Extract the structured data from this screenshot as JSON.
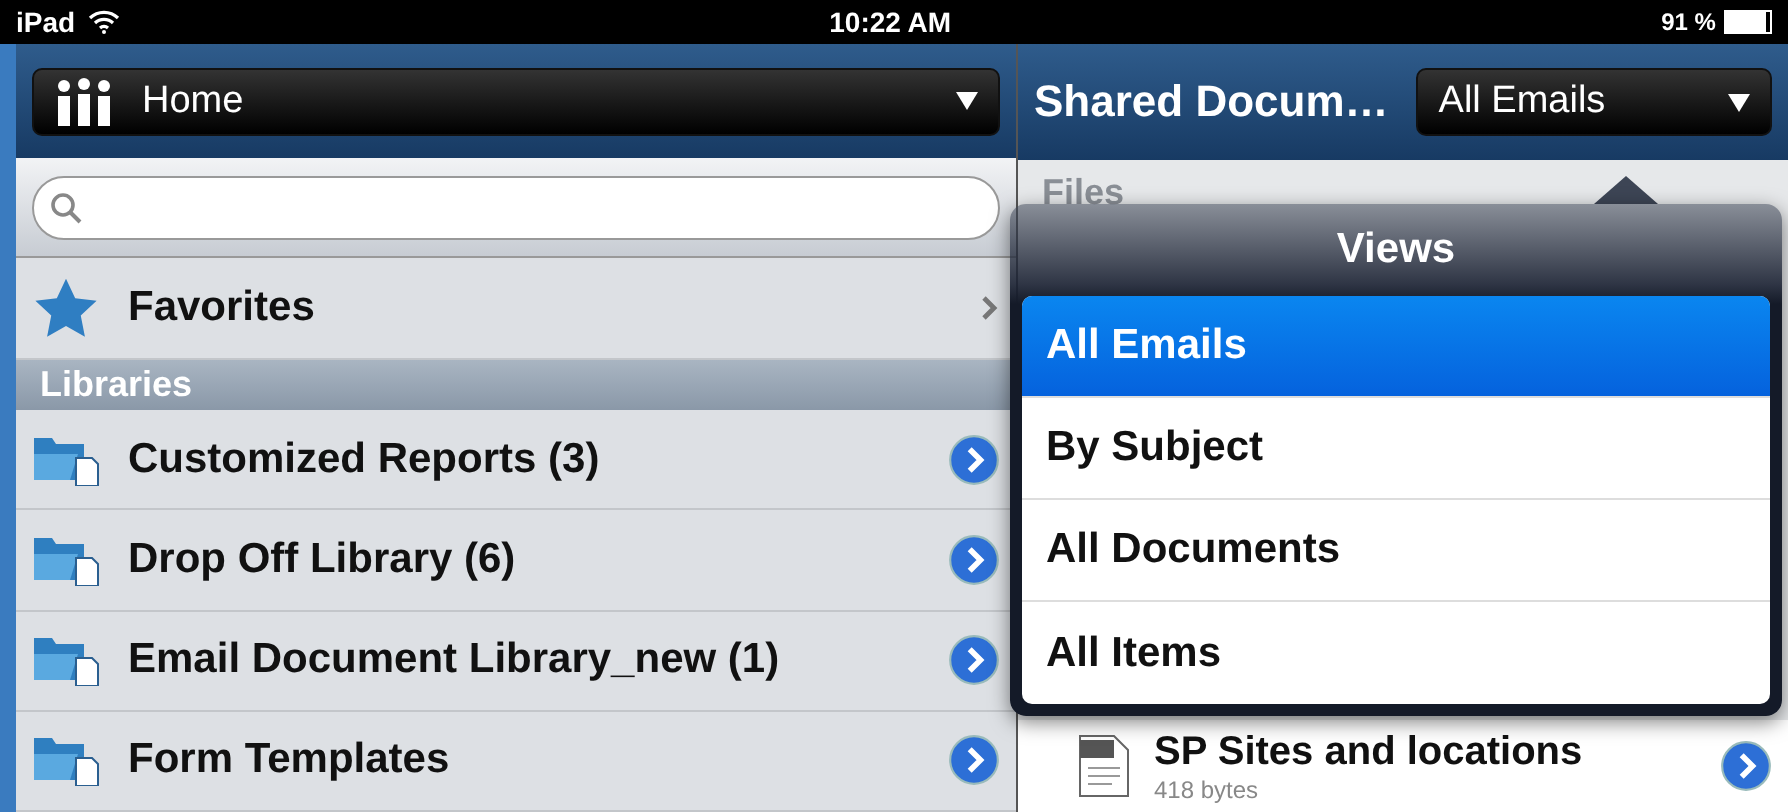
{
  "status_bar": {
    "device": "iPad",
    "time": "10:22 AM",
    "battery": "91 %"
  },
  "left_nav": {
    "site": "Home"
  },
  "favorites": {
    "label": "Favorites"
  },
  "libraries": {
    "header": "Libraries",
    "items": [
      {
        "name": "Customized Reports (3)"
      },
      {
        "name": "Drop Off Library (6)"
      },
      {
        "name": "Email Document Library_new (1)"
      },
      {
        "name": "Form Templates"
      }
    ]
  },
  "right_nav": {
    "title": "Shared Docum…",
    "view": "All Emails"
  },
  "files": {
    "header": "Files",
    "items": [
      {
        "name": "SP Sites and locations",
        "size": "418 bytes"
      }
    ]
  },
  "views_popover": {
    "title": "Views",
    "options": [
      {
        "label": "All Emails",
        "selected": true
      },
      {
        "label": "By Subject",
        "selected": false
      },
      {
        "label": "All Documents",
        "selected": false
      },
      {
        "label": "All Items",
        "selected": false
      }
    ]
  }
}
